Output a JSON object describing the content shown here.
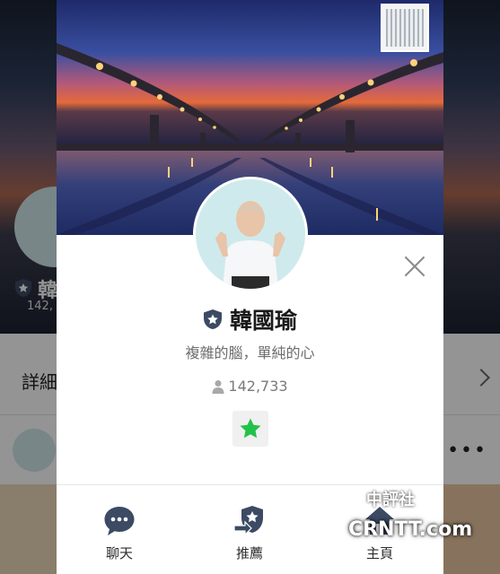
{
  "profile": {
    "name": "韓國瑜",
    "status_message": "複雜的腦，單純的心",
    "followers": "142,733",
    "badge_icon": "verified-shield-icon",
    "favorite_icon": "star-icon",
    "favorite_color": "#22c24a"
  },
  "actions": [
    {
      "label": "聊天",
      "icon": "chat-bubble-icon"
    },
    {
      "label": "推薦",
      "icon": "recommend-share-icon"
    },
    {
      "label": "主頁",
      "icon": "home-icon"
    }
  ],
  "background": {
    "name_partial": "韓",
    "followers_partial": "142,",
    "detail_label": "詳細"
  },
  "watermark": {
    "text": "CRNTT.com",
    "text_cn": "中評社"
  },
  "colors": {
    "modal_bg": "#ffffff",
    "text_primary": "#1a1a1a",
    "text_secondary": "#6d6d6d",
    "icon_dark": "#3c4a63"
  }
}
